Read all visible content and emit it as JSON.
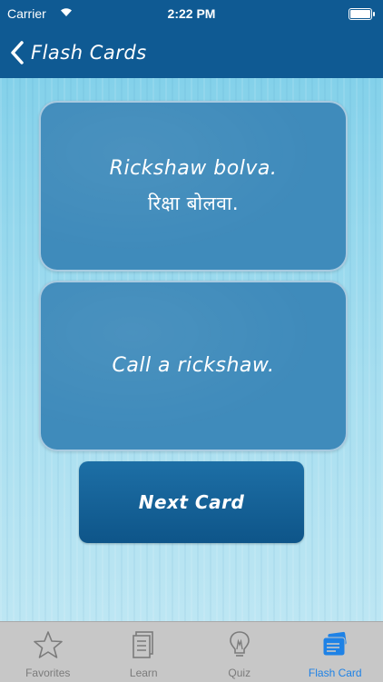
{
  "status": {
    "carrier": "Carrier",
    "time": "2:22 PM"
  },
  "nav": {
    "back_label": "Flash Cards"
  },
  "card_front": {
    "line1": "Rickshaw bolva.",
    "line2": "रिक्षा बोलवा."
  },
  "card_back": {
    "text": "Call a rickshaw."
  },
  "next_button": {
    "label": "Next Card"
  },
  "tabs": [
    {
      "label": "Favorites",
      "icon": "star-icon"
    },
    {
      "label": "Learn",
      "icon": "document-icon"
    },
    {
      "label": "Quiz",
      "icon": "lightbulb-icon"
    },
    {
      "label": "Flash Card",
      "icon": "flash-card-icon",
      "active": true
    }
  ],
  "colors": {
    "nav": "#0f5a93",
    "card": "#3f8bbb",
    "button": "#0e5589",
    "active_tab": "#1e82e6"
  }
}
